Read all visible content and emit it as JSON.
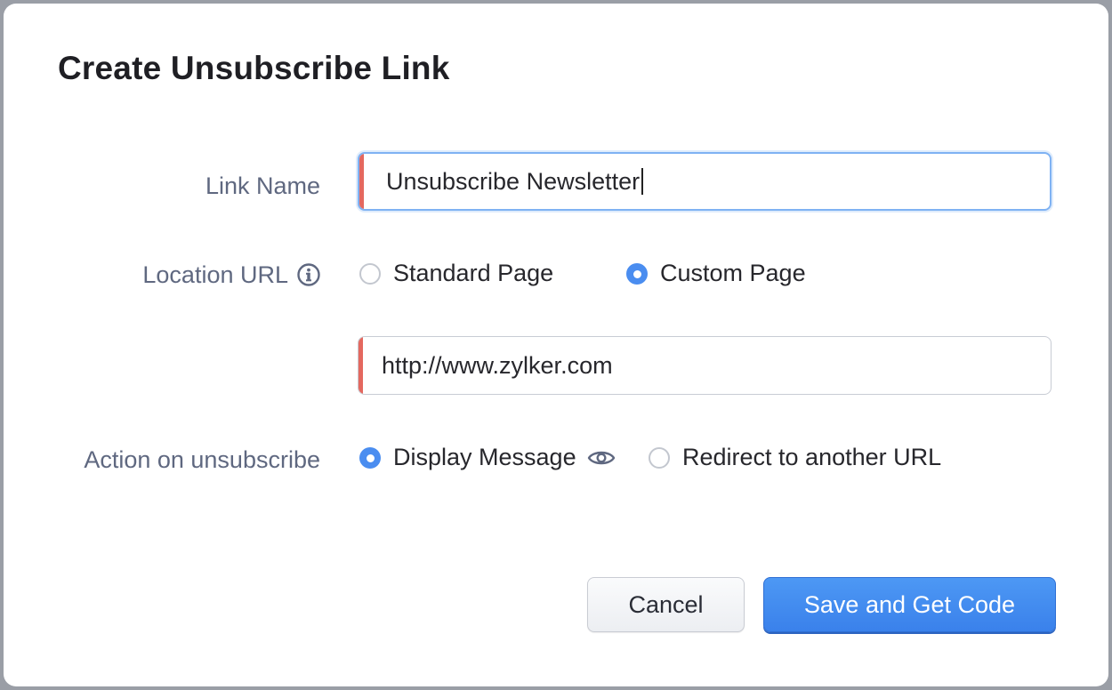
{
  "dialog": {
    "title": "Create Unsubscribe Link"
  },
  "form": {
    "link_name": {
      "label": "Link Name",
      "value": "Unsubscribe Newsletter"
    },
    "location_url": {
      "label": "Location URL",
      "info_icon": "info-icon",
      "options": [
        {
          "label": "Standard Page",
          "selected": false
        },
        {
          "label": "Custom Page",
          "selected": true
        }
      ],
      "url_value": "http://www.zylker.com"
    },
    "action_on_unsubscribe": {
      "label": "Action on unsubscribe",
      "options": [
        {
          "label": "Display Message",
          "selected": true,
          "icon": "eye-icon"
        },
        {
          "label": "Redirect to another URL",
          "selected": false
        }
      ]
    }
  },
  "buttons": {
    "cancel": "Cancel",
    "save": "Save and Get Code"
  },
  "colors": {
    "accent": "#4a8df0",
    "required": "#e4685f",
    "label": "#5f6880",
    "focus": "#7fb2f3"
  }
}
